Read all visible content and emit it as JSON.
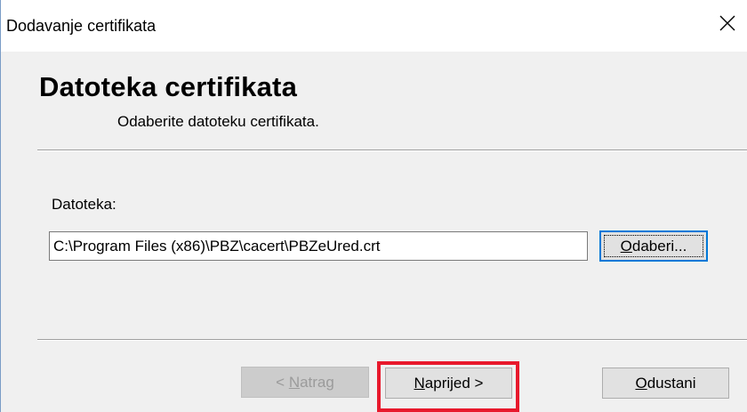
{
  "window": {
    "title": "Dodavanje certifikata",
    "close_glyph": "✕"
  },
  "header": {
    "title": "Datoteka certifikata",
    "subtitle": "Odaberite datoteku certifikata."
  },
  "form": {
    "file_label": "Datoteka:",
    "file_value": "C:\\Program Files (x86)\\PBZ\\cacert\\PBZeUred.crt",
    "browse_label_mnemonic": "O",
    "browse_label_rest": "daberi..."
  },
  "footer": {
    "back_label_prefix": "< ",
    "back_label_mnemonic": "N",
    "back_label_rest": "atrag",
    "next_label_mnemonic": "N",
    "next_label_rest": "aprijed >",
    "cancel_label_mnemonic": "O",
    "cancel_label_rest": "dustani"
  },
  "colors": {
    "highlight": "#e8192c",
    "focus_blue": "#0078d7"
  }
}
